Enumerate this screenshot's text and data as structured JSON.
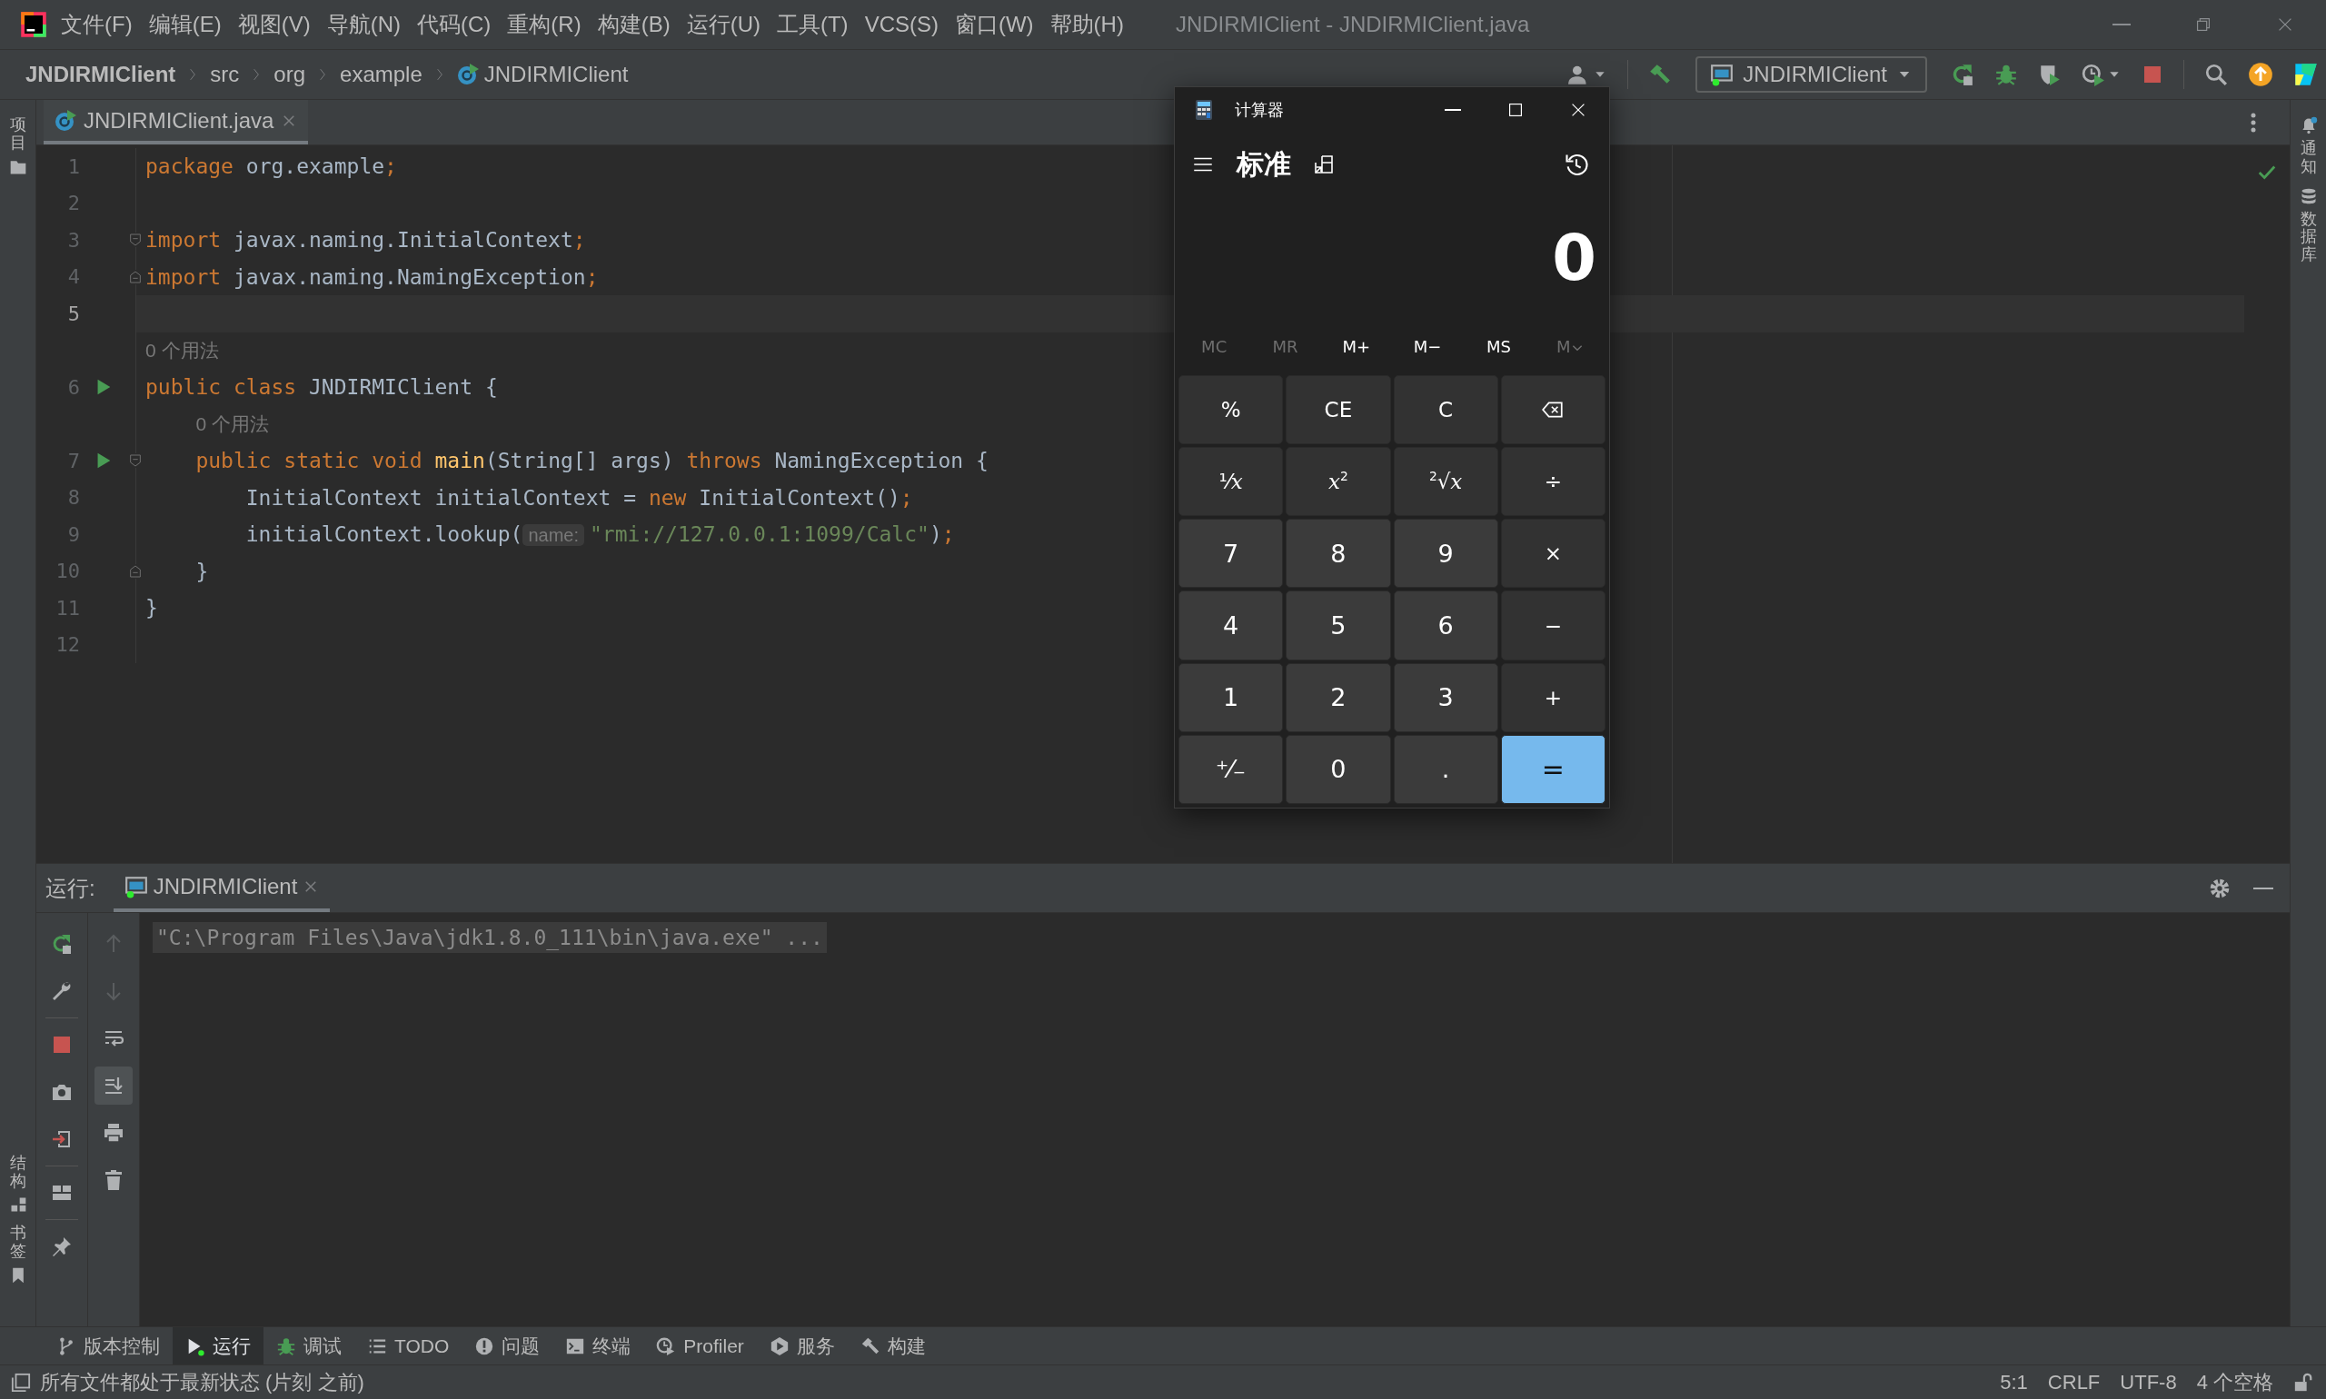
{
  "menu_bar": {
    "items": [
      "文件(F)",
      "编辑(E)",
      "视图(V)",
      "导航(N)",
      "代码(C)",
      "重构(R)",
      "构建(B)",
      "运行(U)",
      "工具(T)",
      "VCS(S)",
      "窗口(W)",
      "帮助(H)"
    ],
    "title": "JNDIRMIClient - JNDIRMIClient.java"
  },
  "navigation": {
    "breadcrumbs": [
      "JNDIRMIClient",
      "src",
      "org",
      "example",
      "JNDIRMIClient"
    ],
    "run_configuration": "JNDIRMIClient"
  },
  "left_tool_strip": [
    "项目",
    "结构",
    "书签"
  ],
  "right_tool_strip": [
    "通知",
    "数据库"
  ],
  "editor": {
    "tabs": [
      {
        "label": "JNDIRMIClient.java",
        "selected": true
      }
    ],
    "lines": [
      {
        "number": "1",
        "current": false,
        "runnable": false,
        "fold_start": false,
        "fold_end": false,
        "tokens": [
          {
            "kind": "keyword",
            "text": "package"
          },
          {
            "kind": "plain",
            "text": " org.example"
          },
          {
            "kind": "punct",
            "text": ";"
          }
        ]
      },
      {
        "number": "2",
        "current": false,
        "runnable": false,
        "fold_start": false,
        "fold_end": false
      },
      {
        "number": "3",
        "current": false,
        "runnable": false,
        "fold_start": true,
        "fold_end": false,
        "tokens": [
          {
            "kind": "keyword",
            "text": "import"
          },
          {
            "kind": "plain",
            "text": " javax.naming.InitialContext"
          },
          {
            "kind": "punct",
            "text": ";"
          }
        ]
      },
      {
        "number": "4",
        "current": false,
        "runnable": false,
        "fold_start": false,
        "fold_end": true,
        "tokens": [
          {
            "kind": "keyword",
            "text": "import"
          },
          {
            "kind": "plain",
            "text": " javax.naming.NamingException"
          },
          {
            "kind": "punct",
            "text": ";"
          }
        ]
      },
      {
        "number": "5",
        "current": true,
        "runnable": false,
        "fold_start": false,
        "fold_end": false
      },
      {
        "number": "6",
        "current": false,
        "runnable": true,
        "fold_start": false,
        "fold_end": false,
        "usages": "0 个用法",
        "tokens": [
          {
            "kind": "keyword",
            "text": "public class"
          },
          {
            "kind": "plain",
            "text": " JNDIRMIClient {"
          }
        ]
      },
      {
        "number": "7",
        "current": false,
        "runnable": true,
        "fold_start": true,
        "fold_end": false,
        "usages": "0 个用法",
        "tokens": [
          {
            "kind": "keyword",
            "text": "    public static void "
          },
          {
            "kind": "method",
            "text": "main"
          },
          {
            "kind": "plain",
            "text": "(String[] args) "
          },
          {
            "kind": "keyword",
            "text": "throws"
          },
          {
            "kind": "plain",
            "text": " NamingException {"
          }
        ]
      },
      {
        "number": "8",
        "current": false,
        "runnable": false,
        "fold_start": false,
        "fold_end": false,
        "tokens": [
          {
            "kind": "plain",
            "text": "        InitialContext initialContext = "
          },
          {
            "kind": "keyword",
            "text": "new"
          },
          {
            "kind": "plain",
            "text": " InitialContext()"
          },
          {
            "kind": "punct",
            "text": ";"
          }
        ]
      },
      {
        "number": "9",
        "current": false,
        "runnable": false,
        "fold_start": false,
        "fold_end": false,
        "tokens": [
          {
            "kind": "plain",
            "text": "        initialContext.lookup("
          },
          {
            "kind": "hint",
            "text": "name:"
          },
          {
            "kind": "string",
            "text": "\"rmi://127.0.0.1:1099/Calc\""
          },
          {
            "kind": "plain",
            "text": ")"
          },
          {
            "kind": "punct",
            "text": ";"
          }
        ]
      },
      {
        "number": "10",
        "current": false,
        "runnable": false,
        "fold_start": false,
        "fold_end": true,
        "tokens": [
          {
            "kind": "plain",
            "text": "    }"
          }
        ]
      },
      {
        "number": "11",
        "current": false,
        "runnable": false,
        "fold_start": false,
        "fold_end": false,
        "tokens": [
          {
            "kind": "plain",
            "text": "}"
          }
        ]
      },
      {
        "number": "12",
        "current": false,
        "runnable": false,
        "fold_start": false,
        "fold_end": false
      }
    ]
  },
  "calculator": {
    "title": "计算器",
    "mode": "标准",
    "display": "0",
    "memory": [
      {
        "label": "MC",
        "disabled": true,
        "has_menu": false
      },
      {
        "label": "MR",
        "disabled": true,
        "has_menu": false
      },
      {
        "label": "M+",
        "disabled": false,
        "has_menu": false
      },
      {
        "label": "M−",
        "disabled": false,
        "has_menu": false
      },
      {
        "label": "MS",
        "disabled": false,
        "has_menu": false
      },
      {
        "label": "M",
        "disabled": true,
        "has_menu": true
      }
    ],
    "keys": [
      {
        "kind": "function",
        "label": "%"
      },
      {
        "kind": "function",
        "label": "CE"
      },
      {
        "kind": "function",
        "label": "C"
      },
      {
        "kind": "backspace"
      },
      {
        "kind": "function",
        "label": "¹⁄*x*"
      },
      {
        "kind": "function",
        "label": "*x*$^{2}$"
      },
      {
        "kind": "function",
        "label": "$^{2}$√*x*"
      },
      {
        "kind": "function",
        "label": "÷"
      },
      {
        "kind": "number",
        "label": "7"
      },
      {
        "kind": "number",
        "label": "8"
      },
      {
        "kind": "number",
        "label": "9"
      },
      {
        "kind": "function",
        "label": "×"
      },
      {
        "kind": "number",
        "label": "4"
      },
      {
        "kind": "number",
        "label": "5"
      },
      {
        "kind": "number",
        "label": "6"
      },
      {
        "kind": "function",
        "label": "−"
      },
      {
        "kind": "number",
        "label": "1"
      },
      {
        "kind": "number",
        "label": "2"
      },
      {
        "kind": "number",
        "label": "3"
      },
      {
        "kind": "function",
        "label": "+"
      },
      {
        "kind": "number",
        "label": "⁺⁄₋"
      },
      {
        "kind": "number",
        "label": "0"
      },
      {
        "kind": "number",
        "label": "."
      },
      {
        "kind": "equals",
        "label": "="
      }
    ]
  },
  "run_panel": {
    "label": "运行:",
    "tabs": [
      {
        "label": "JNDIRMIClient",
        "selected": true
      }
    ],
    "auto_scroll": true,
    "output": [
      "\"C:\\Program Files\\Java\\jdk1.8.0_111\\bin\\java.exe\" ..."
    ]
  },
  "tool_tabs": [
    {
      "label": "版本控制",
      "selected": false
    },
    {
      "label": "运行",
      "selected": true
    },
    {
      "label": "调试",
      "selected": false
    },
    {
      "label": "TODO",
      "selected": false
    },
    {
      "label": "问题",
      "selected": false
    },
    {
      "label": "终端",
      "selected": false
    },
    {
      "label": "Profiler",
      "selected": false
    },
    {
      "label": "服务",
      "selected": false
    },
    {
      "label": "构建",
      "selected": false
    }
  ],
  "status_bar": {
    "message": "所有文件都处于最新状态 (片刻 之前)",
    "items": [
      "5:1",
      "CRLF",
      "UTF-8",
      "4 个空格"
    ]
  }
}
